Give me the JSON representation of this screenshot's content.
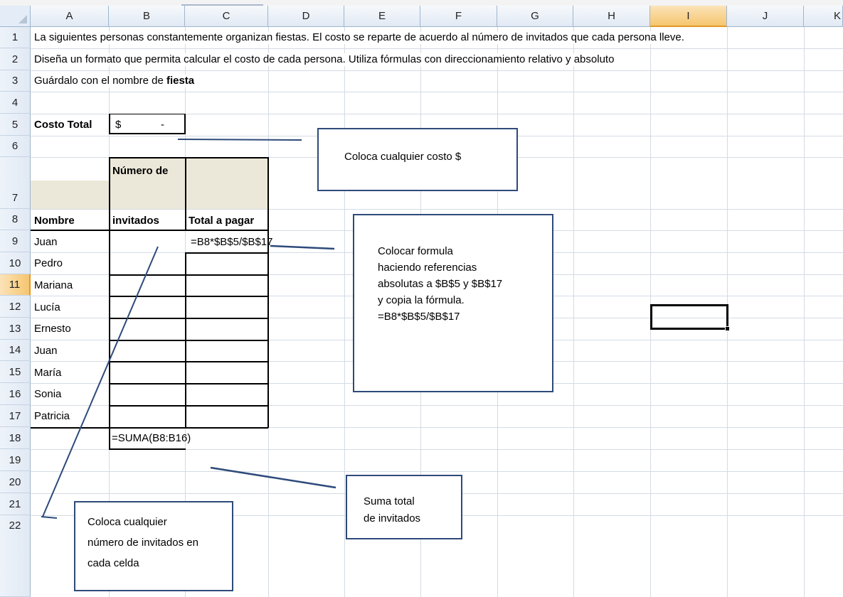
{
  "columns": [
    "A",
    "B",
    "C",
    "D",
    "E",
    "F",
    "G",
    "H",
    "I",
    "J",
    "K"
  ],
  "selected_column": "I",
  "rows": [
    "1",
    "2",
    "3",
    "4",
    "5",
    "6",
    "7",
    "8",
    "9",
    "10",
    "11",
    "12",
    "13",
    "14",
    "15",
    "16",
    "17",
    "18",
    "19",
    "20",
    "21",
    "22"
  ],
  "selected_row": "11",
  "instructions": {
    "line1": "La siguientes personas constantemente organizan fiestas. El costo se reparte de acuerdo al número de invitados que cada persona lleve.",
    "line2": "Diseña un formato que permita calcular el costo de cada persona. Utiliza fórmulas con direccionamiento relativo y absoluto",
    "line3_prefix": "Guárdalo con el nombre de ",
    "line3_bold": "fiesta"
  },
  "cost": {
    "label": "Costo Total",
    "currency": "$",
    "value": "-"
  },
  "table": {
    "headers": {
      "name": "Nombre",
      "guests_line1": "Número de",
      "guests_line2": "invitados",
      "total": "Total a pagar"
    },
    "names": [
      "Juan",
      "Pedro",
      "Mariana",
      "Lucía",
      "Ernesto",
      "Juan",
      "María",
      "Sonia",
      "Patricia"
    ],
    "formula_c8": "=B8*$B$5/$B$17",
    "formula_b17": "=SUMA(B8:B16)"
  },
  "callouts": {
    "cost": "Coloca cualquier costo $",
    "formula": [
      "Colocar formula",
      "haciendo referencias",
      "absolutas a $B$5 y $B$17",
      "y copia la fórmula.",
      "=B8*$B$5/$B$17"
    ],
    "sum": [
      "Suma total",
      "de invitados"
    ],
    "guests": [
      "Coloca cualquier",
      "número de invitados  en",
      "cada celda"
    ]
  },
  "colors": {
    "callout_border": "#2e4a7a",
    "header_fill": "#ece8d9",
    "selection_header": "#f6c66f",
    "grid": "#d4dbe4"
  }
}
